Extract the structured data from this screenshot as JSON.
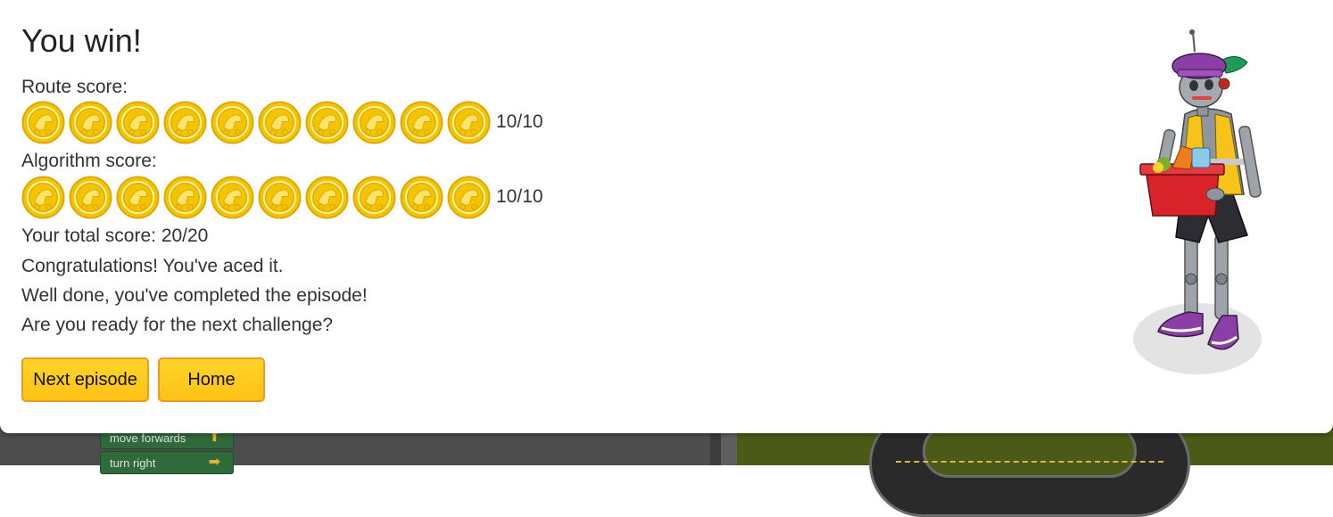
{
  "dialog": {
    "title": "You win!",
    "route_score_label": "Route score:",
    "route_score_value": "10/10",
    "route_coins_earned": 10,
    "route_coins_total": 10,
    "algorithm_score_label": "Algorithm score:",
    "algorithm_score_value": "10/10",
    "algorithm_coins_earned": 10,
    "algorithm_coins_total": 10,
    "total_score": "Your total score: 20/20",
    "message_1": "Congratulations! You've aced it.",
    "message_2": "Well done, you've completed the episode!",
    "message_3": "Are you ready for the next challenge?",
    "next_button": "Next episode",
    "home_button": "Home"
  },
  "background": {
    "blocks": [
      {
        "label": "move forwards",
        "icon": "arrow-up-icon"
      },
      {
        "label": "turn right",
        "icon": "arrow-right-icon"
      }
    ]
  },
  "colors": {
    "coin_gold": "#f5c400",
    "coin_edge": "#e0a800",
    "button_fill": "#ffc916",
    "button_border": "#f09a25",
    "map_grass": "#4c5a17",
    "block_green": "#2f6a3a"
  },
  "icons": {
    "coin": "gold-coin-icon",
    "character": "robot-van-driver-character"
  }
}
